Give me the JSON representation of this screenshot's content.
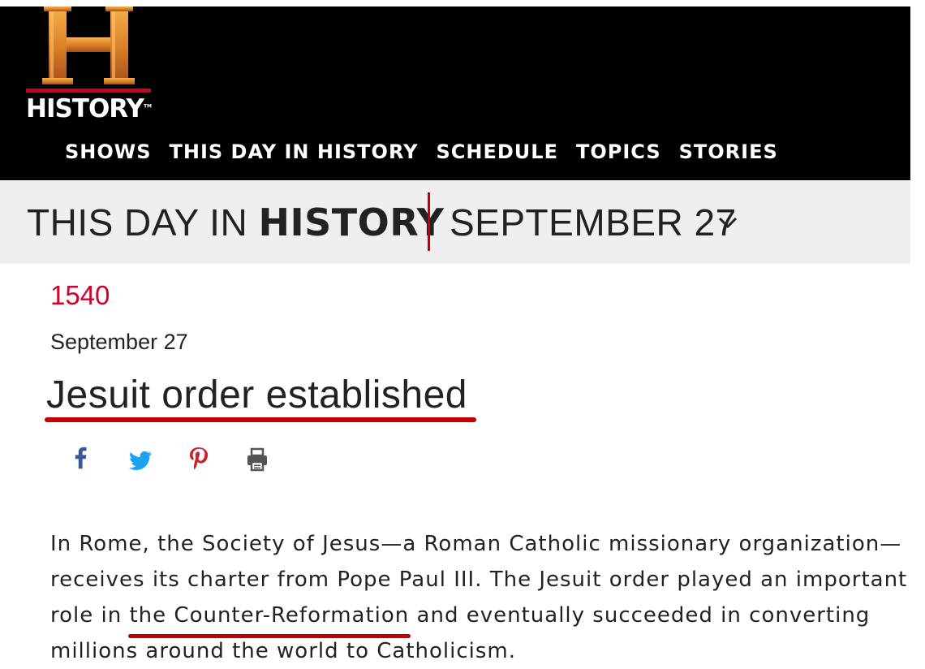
{
  "brand": {
    "name": "HISTORY",
    "trademark": "TM",
    "colors": {
      "gold_top": "#f5a93a",
      "gold_bottom": "#b3561a",
      "red_bar": "#d0021b",
      "accent_red": "#d3002a"
    }
  },
  "nav": {
    "items": [
      {
        "label": "SHOWS"
      },
      {
        "label": "THIS DAY IN HISTORY"
      },
      {
        "label": "SCHEDULE"
      },
      {
        "label": "TOPICS"
      },
      {
        "label": "STORIES"
      }
    ]
  },
  "band": {
    "title_light": "THIS DAY IN",
    "title_bold": "HISTORY",
    "date": "SEPTEMBER 27",
    "date_icon": "chevron-down-icon"
  },
  "article": {
    "year": "1540",
    "date": "September 27",
    "headline": "Jesuit order established",
    "share_icons": [
      "facebook-icon",
      "twitter-icon",
      "pinterest-icon",
      "print-icon"
    ],
    "body_lines": [
      "In Rome, the Society of Jesus—a Roman Catholic missionary organization—",
      "receives its charter from Pope Paul III. The Jesuit order played an important"
    ],
    "line3_before": "role in ",
    "line3_link": "the Counter-Reformation",
    "line3_after": " and eventually succeeded in converting",
    "line4": "millions around the world to Catholicism."
  }
}
